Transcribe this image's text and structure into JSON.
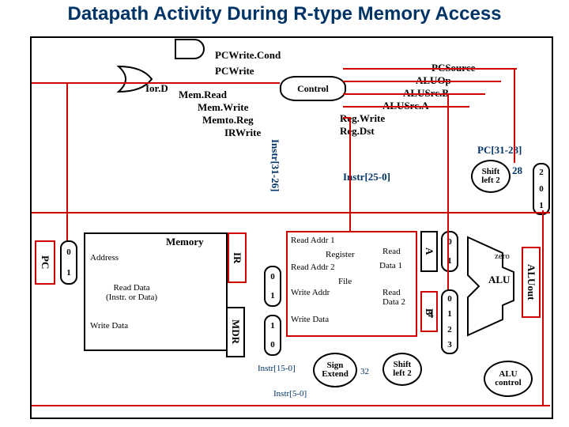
{
  "title": "Datapath Activity During R-type Memory Access",
  "labels": {
    "pcwritecond": "PCWrite.Cond",
    "pcwrite": "PCWrite",
    "iord": "Ior.D",
    "memread": "Mem.Read",
    "memwrite": "Mem.Write",
    "memtoreg": "Memto.Reg",
    "irwrite": "IRWrite",
    "control": "Control",
    "pcsource": "PCSource",
    "aluop": "ALUOp",
    "alusrcb": "ALUSrc.B",
    "alusrca": "ALUSrc.A",
    "regwrite": "Reg.Write",
    "regdst": "Reg.Dst",
    "instr3126": "Instr[31-26]",
    "pc3128": "PC[31-28]",
    "instr250": "Instr[25-0]",
    "shiftleft2a": "Shift\nleft 2",
    "n28": "28",
    "muxr0": "0",
    "muxr1": "1",
    "muxr2": "2",
    "pc": "PC",
    "address": "Address",
    "memory": "Memory",
    "read_data": "Read Data\n(Instr. or Data)",
    "write_data": "Write Data",
    "ir": "IR",
    "mdr": "MDR",
    "readaddr1": "Read Addr  1",
    "register": "Register",
    "readaddr2": "Read Addr  2",
    "read": "Read",
    "data1": "Data 1",
    "file": "File",
    "writeaddr": "Write Addr",
    "readdata2": "Read\nData 2",
    "write_data2": "Write Data",
    "a": "A",
    "b": "B",
    "zero": "zero",
    "alu": "ALU",
    "aluout": "ALUout",
    "instr150": "Instr[15-0]",
    "sign_extend": "Sign\nExtend",
    "n32": "32",
    "shiftleft2b": "Shift\nleft 2",
    "instr50": "Instr[5-0]",
    "alu_control": "ALU\ncontrol",
    "n4": "4",
    "m0": "0",
    "m1": "1",
    "m2b": "2",
    "m3": "3"
  },
  "chart_data": {
    "type": "table",
    "description": "MIPS multicycle datapath diagram showing control signals and components active during the memory access stage of an R-type instruction",
    "control_signals": [
      "PCWrite.Cond",
      "PCWrite",
      "Ior.D",
      "Mem.Read",
      "Mem.Write",
      "Memto.Reg",
      "IRWrite",
      "PCSource",
      "ALUOp",
      "ALUSrc.B",
      "ALUSrc.A",
      "Reg.Write",
      "Reg.Dst"
    ],
    "components": [
      "PC",
      "Memory",
      "IR",
      "MDR",
      "Register File",
      "A",
      "B",
      "ALU",
      "ALUout",
      "Sign Extend",
      "Shift left 2",
      "ALU control"
    ],
    "instruction_fields": [
      "Instr[31-26]",
      "Instr[25-0]",
      "Instr[15-0]",
      "Instr[5-0]",
      "PC[31-28]"
    ]
  }
}
